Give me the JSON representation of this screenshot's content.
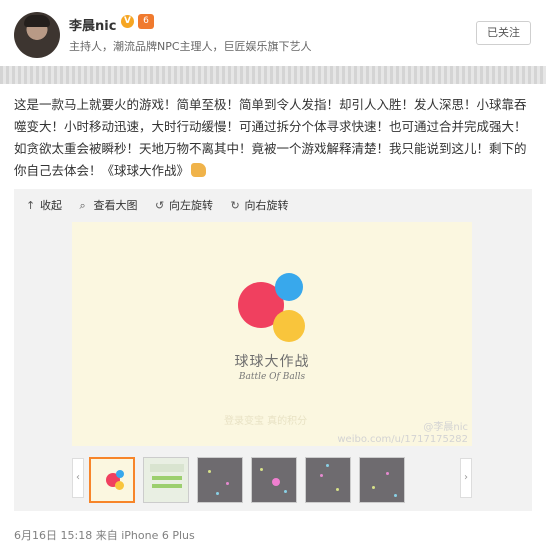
{
  "author": {
    "name": "李晨nic",
    "verified_badge": "V",
    "level_badge": "6",
    "bio": "主持人，潮流品牌NPC主理人，巨匠娱乐旗下艺人"
  },
  "follow_button": "已关注",
  "post": {
    "text": "这是一款马上就要火的游戏！简单至极！简单到令人发指！却引人入胜！发人深思！小球靠吞噬变大！小时移动迅速，大时行动缓慢！可通过拆分个体寻求快速！也可通过合并完成强大！如贪欲太重会被瞬秒！天地万物不离其中！竟被一个游戏解释清楚！我只能说到这儿！剩下的你自己去体会！《球球大作战》"
  },
  "media_toolbar": {
    "collapse": {
      "icon": "collapse-up-icon",
      "label": "收起"
    },
    "view_large": {
      "icon": "magnifier-icon",
      "label": "查看大图"
    },
    "rotate_left": {
      "icon": "rotate-left-icon",
      "label": "向左旋转"
    },
    "rotate_right": {
      "icon": "rotate-right-icon",
      "label": "向右旋转"
    }
  },
  "image": {
    "title_cn": "球球大作战",
    "title_en": "Battle Of Balls",
    "faint_links": "登录变宝    真的积分",
    "watermark_line1": "@李晨nic",
    "watermark_line2": "weibo.com/u/1717175282",
    "background": "#fbf7e0",
    "ball_colors": [
      "#f0405f",
      "#38a8ec",
      "#f9c53c"
    ]
  },
  "thumbnails_count": 6,
  "accent": "#f7852a",
  "footer": {
    "date": "6月16日 15:18",
    "source_prefix": "来自",
    "source": "iPhone 6 Plus"
  }
}
